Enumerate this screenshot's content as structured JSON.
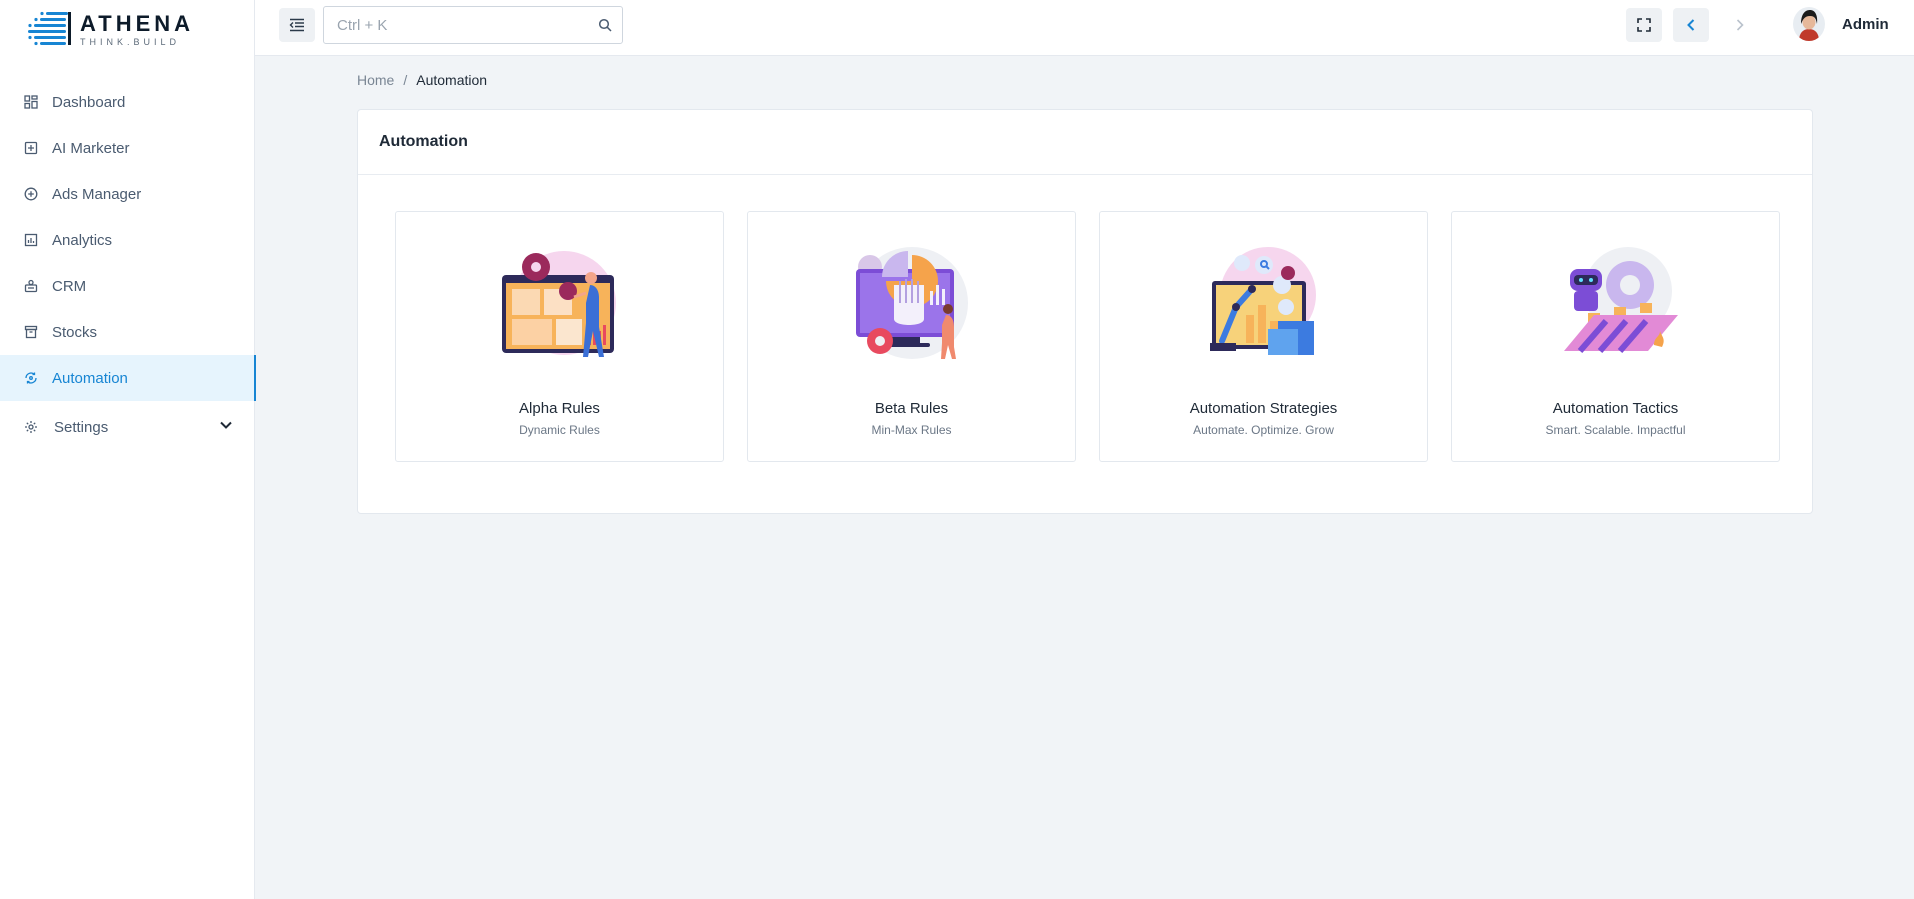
{
  "brand": {
    "name": "ATHENA",
    "tagline": "THINK.BUILD"
  },
  "sidebar": {
    "items": [
      {
        "label": "Dashboard",
        "icon": "grid-icon"
      },
      {
        "label": "AI Marketer",
        "icon": "ai-box-icon"
      },
      {
        "label": "Ads Manager",
        "icon": "plus-circle-icon"
      },
      {
        "label": "Analytics",
        "icon": "bar-chart-icon"
      },
      {
        "label": "CRM",
        "icon": "crm-icon"
      },
      {
        "label": "Stocks",
        "icon": "archive-icon"
      },
      {
        "label": "Automation",
        "icon": "automation-icon",
        "active": true
      },
      {
        "label": "Settings",
        "icon": "gear-icon",
        "expandable": true
      }
    ]
  },
  "header": {
    "search_placeholder": "Ctrl + K",
    "user_name": "Admin"
  },
  "breadcrumb": {
    "home": "Home",
    "separator": "/",
    "current": "Automation"
  },
  "main": {
    "card_title": "Automation",
    "tiles": [
      {
        "title": "Alpha Rules",
        "subtitle": "Dynamic Rules"
      },
      {
        "title": "Beta Rules",
        "subtitle": "Min-Max Rules"
      },
      {
        "title": "Automation Strategies",
        "subtitle": "Automate. Optimize. Grow"
      },
      {
        "title": "Automation Tactics",
        "subtitle": "Smart. Scalable. Impactful"
      }
    ]
  },
  "colors": {
    "accent": "#1785d3",
    "active_bg": "#e6f4fd",
    "page_bg": "#f1f4f7"
  }
}
